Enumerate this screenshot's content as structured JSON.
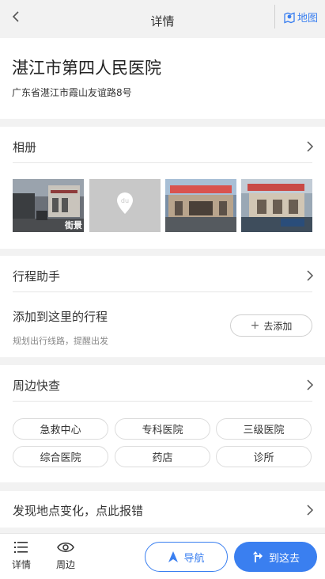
{
  "header": {
    "title": "详情",
    "map_label": "地图"
  },
  "place": {
    "name": "湛江市第四人民医院",
    "address": "广东省湛江市霞山友谊路8号"
  },
  "album": {
    "title": "相册",
    "street_view_tag": "街景",
    "placeholder_logo": "du"
  },
  "trip": {
    "title": "行程助手",
    "main_text": "添加到这里的行程",
    "sub_text": "规划出行线路，提醒出发",
    "add_button": "去添加"
  },
  "nearby": {
    "title": "周边快查",
    "chips": [
      "急救中心",
      "专科医院",
      "三级医院",
      "综合医院",
      "药店",
      "诊所"
    ]
  },
  "report": {
    "text": "发现地点变化，点此报错"
  },
  "bottom": {
    "tab_detail": "详情",
    "tab_nearby": "周边",
    "navigate_label": "导航",
    "go_here_label": "到这去"
  },
  "colors": {
    "accent": "#3a7ff0",
    "page_background": "#f2f2f2"
  }
}
